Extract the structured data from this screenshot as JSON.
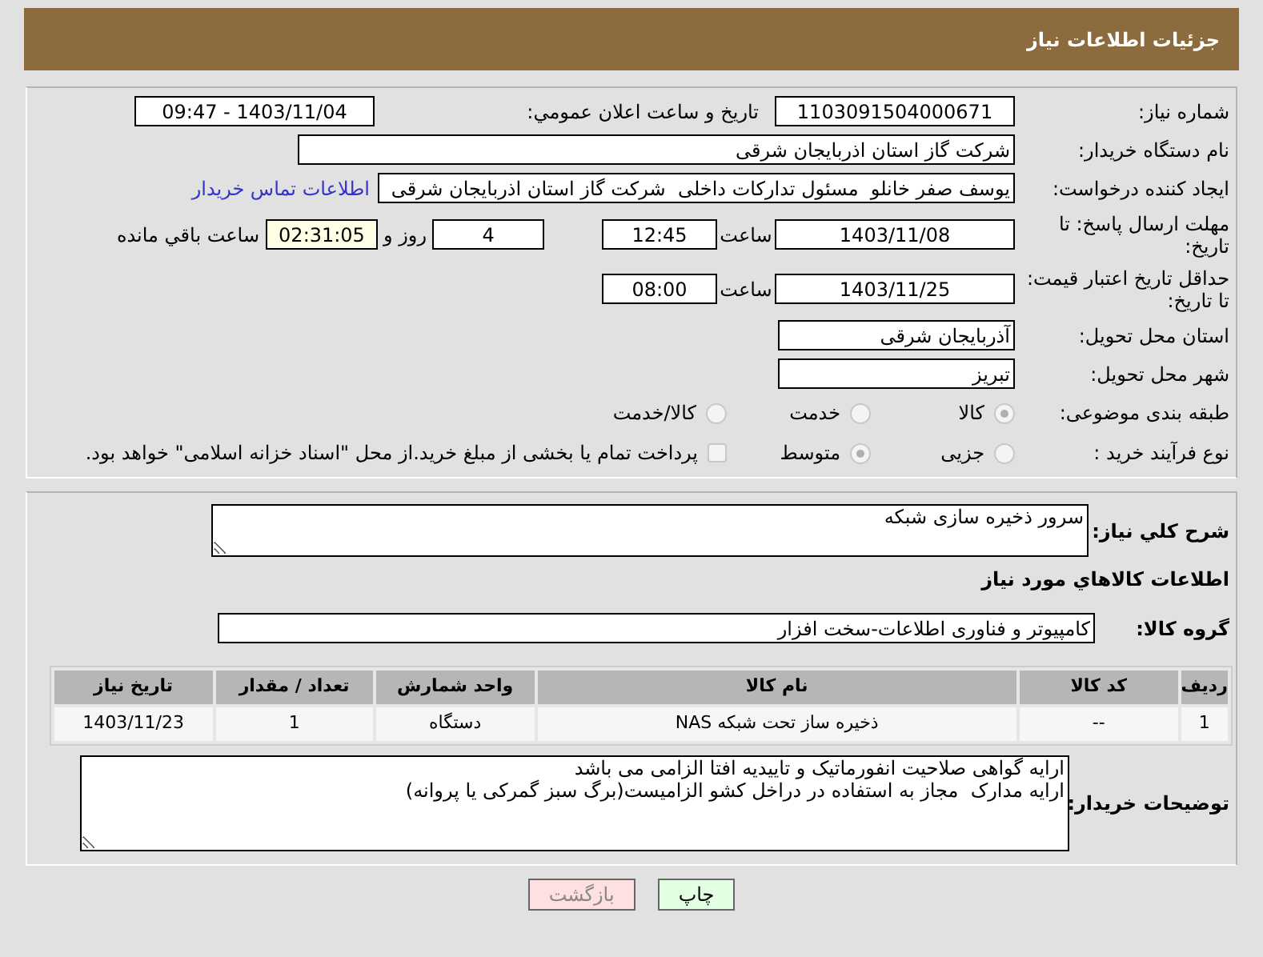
{
  "header": {
    "title": "جزئیات اطلاعات نیاز"
  },
  "need_number": {
    "label": "شماره نیاز:",
    "value": "1103091504000671"
  },
  "announce": {
    "label": "تاریخ و ساعت اعلان عمومي:",
    "value": "1403/11/04 - 09:47"
  },
  "buyer": {
    "label": "نام دستگاه خریدار:",
    "value": "شرکت گاز استان اذربایجان شرقی"
  },
  "requester": {
    "label": "ایجاد کننده درخواست:",
    "value": "یوسف صفر خانلو  مسئول تدارکات داخلی  شرکت گاز استان اذربایجان شرقی",
    "link": "اطلاعات تماس خریدار"
  },
  "deadline": {
    "label": "مهلت ارسال پاسخ: تا تاریخ:",
    "date": "1403/11/08",
    "time_label": "ساعت",
    "time": "12:45",
    "days": "4",
    "days_label": "روز و",
    "remaining": "02:31:05",
    "remaining_label": "ساعت باقي مانده"
  },
  "validity": {
    "label": "حداقل تاریخ اعتبار قیمت: تا تاریخ:",
    "date": "1403/11/25",
    "time_label": "ساعت",
    "time": "08:00"
  },
  "province": {
    "label": "استان محل تحویل:",
    "value": "آذربایجان شرقی"
  },
  "city": {
    "label": "شهر محل تحویل:",
    "value": "تبریز"
  },
  "category": {
    "label": "طبقه بندی موضوعی:",
    "options": [
      {
        "label": "کالا",
        "selected": true
      },
      {
        "label": "خدمت",
        "selected": false
      },
      {
        "label": "کالا/خدمت",
        "selected": false
      }
    ]
  },
  "process": {
    "label": "نوع فرآیند خرید :",
    "options": [
      {
        "label": "جزیی",
        "selected": false
      },
      {
        "label": "متوسط",
        "selected": true
      }
    ],
    "payment": {
      "checked": false,
      "text": "پرداخت تمام یا بخشی از مبلغ خرید.از محل \"اسناد خزانه اسلامی\" خواهد بود."
    }
  },
  "summary": {
    "label": "شرح کلي نياز:",
    "value": "سرور ذخیره سازی شبکه"
  },
  "goods_title": "اطلاعات کالاهاي مورد نياز",
  "goods_group": {
    "label": "گروه کالا:",
    "value": "کامپیوتر و فناوری اطلاعات-سخت افزار"
  },
  "table": {
    "columns": [
      "ردیف",
      "کد کالا",
      "نام کالا",
      "واحد شمارش",
      "تعداد / مقدار",
      "تاریخ نیاز"
    ],
    "rows": [
      [
        "1",
        "--",
        "ذخیره ساز تحت شبکه NAS",
        "دستگاه",
        "1",
        "1403/11/23"
      ]
    ]
  },
  "notes": {
    "label": "توضیحات خریدار:",
    "lines": [
      "ارایه گواهی صلاحیت انفورماتیک و تاییدیه افتا الزامی می باشد",
      "ارایه مدارک  مجاز به استفاده در دراخل کشو الزامیست(برگ سبز گمرکی یا پروانه)"
    ]
  },
  "buttons": [
    {
      "label": "چاپ",
      "kind": "print"
    },
    {
      "label": "بازگشت",
      "kind": "back"
    }
  ]
}
